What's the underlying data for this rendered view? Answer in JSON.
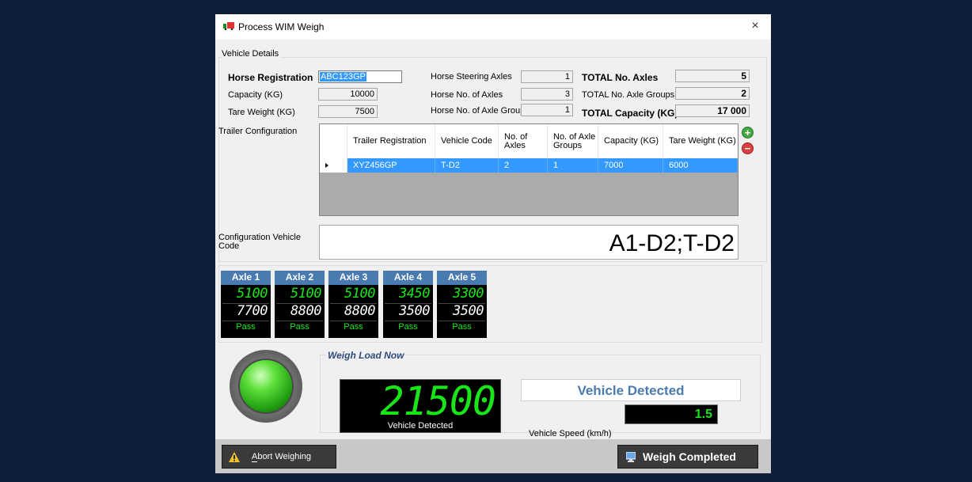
{
  "window": {
    "title": "Process WIM Weigh",
    "close": "×"
  },
  "vehicle_details": {
    "group_title": "Vehicle Details",
    "horse_registration": {
      "label": "Horse Registration",
      "value": "ABC123GP"
    },
    "capacity": {
      "label": "Capacity (KG)",
      "value": "10000"
    },
    "tare_weight": {
      "label": "Tare Weight (KG)",
      "value": "7500"
    },
    "horse_steering_axles": {
      "label": "Horse Steering Axles",
      "value": "1"
    },
    "horse_axles": {
      "label": "Horse No. of Axles",
      "value": "3"
    },
    "horse_axle_groups": {
      "label": "Horse No. of Axle Groups",
      "value": "1"
    },
    "total_axles": {
      "label": "TOTAL No. Axles",
      "value": "5"
    },
    "total_axle_groups": {
      "label": "TOTAL No. Axle Groups",
      "value": "2"
    },
    "total_capacity": {
      "label": "TOTAL Capacity (KG)",
      "value": "17 000"
    },
    "trailer_config_label": "Trailer Configuration",
    "config_vehicle_code_label": "Configuration Vehicle Code",
    "config_vehicle_code": "A1-D2;T-D2"
  },
  "trailer_table": {
    "columns": [
      "Trailer Registration",
      "Vehicle Code",
      "No. of Axles",
      "No. of Axle Groups",
      "Capacity (KG)",
      "Tare Weight (KG)"
    ],
    "rows": [
      [
        "XYZ456GP",
        "T-D2",
        "2",
        "1",
        "7000",
        "6000"
      ]
    ]
  },
  "axles": [
    {
      "label": "Axle 1",
      "weight": "5100",
      "limit": "7700",
      "status": "Pass"
    },
    {
      "label": "Axle 2",
      "weight": "5100",
      "limit": "8800",
      "status": "Pass"
    },
    {
      "label": "Axle 3",
      "weight": "5100",
      "limit": "8800",
      "status": "Pass"
    },
    {
      "label": "Axle 4",
      "weight": "3450",
      "limit": "3500",
      "status": "Pass"
    },
    {
      "label": "Axle 5",
      "weight": "3300",
      "limit": "3500",
      "status": "Pass"
    }
  ],
  "weigh": {
    "title": "Weigh Load Now",
    "total_weight": "21500",
    "display_caption": "Vehicle Detected",
    "detection_status": "Vehicle Detected",
    "speed_label": "Vehicle Speed (km/h)",
    "speed_value": "1.5"
  },
  "footer": {
    "abort_label": "Abort Weighing",
    "complete_label": "Weigh Completed"
  },
  "colors": {
    "accent": "#3399ff",
    "led_green": "#19e619",
    "axle_header": "#4a7bb0",
    "background": "#0f1f3a"
  }
}
